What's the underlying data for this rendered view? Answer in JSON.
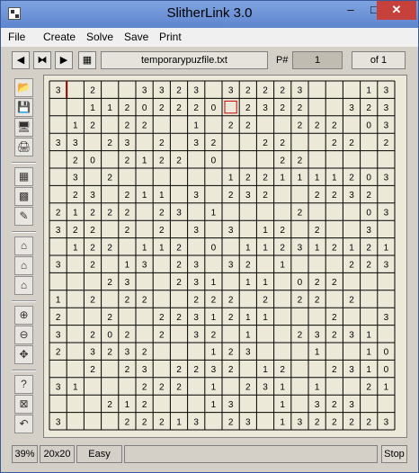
{
  "window": {
    "title": "SlitherLink 3.0"
  },
  "titlebar_buttons": {
    "minimize": "–",
    "maximize": "□",
    "close": "✕"
  },
  "menu": [
    "File",
    "Create",
    "Solve",
    "Save",
    "Print"
  ],
  "toolbar": {
    "nav_icons": [
      "first-icon",
      "prev-icon",
      "next-icon",
      "grid-icon"
    ],
    "filename": "temporarypuzfile.txt",
    "puzzle_label": "P#",
    "puzzle_number": "1",
    "puzzle_of": "of 1"
  },
  "sidebar_icons": [
    "open-folder-icon",
    "save-disk-icon",
    "computer-icon",
    "printer-icon",
    "grid-icon",
    "grid-pattern-icon",
    "edit-puzzle-icon",
    "house-icon",
    "house-icon",
    "house-icon",
    "zoom-in-icon",
    "zoom-out-icon",
    "move-icon",
    "help-icon",
    "cancel-icon",
    "undo-icon"
  ],
  "status": {
    "percent": "39%",
    "size": "20x20",
    "difficulty": "Easy",
    "message": "",
    "stop_label": "Stop"
  },
  "board": {
    "rows": 20,
    "cols": 20,
    "selected_cell": [
      1,
      10
    ],
    "cells": [
      [
        "3",
        "",
        "2",
        "",
        "",
        "3",
        "3",
        "2",
        "3",
        "",
        "3",
        "2",
        "2",
        "2",
        "3",
        "",
        "",
        "",
        "1",
        "3"
      ],
      [
        "",
        "",
        "1",
        "1",
        "2",
        "0",
        "2",
        "2",
        "2",
        "0",
        "",
        "2",
        "3",
        "2",
        "2",
        "",
        "",
        "3",
        "2",
        "3"
      ],
      [
        "",
        "1",
        "2",
        "",
        "2",
        "2",
        "",
        "",
        "1",
        "",
        "2",
        "2",
        "",
        "",
        "2",
        "2",
        "2",
        "",
        "0",
        "3"
      ],
      [
        "3",
        "3",
        "",
        "2",
        "3",
        "",
        "2",
        "",
        "3",
        "2",
        "",
        "",
        "2",
        "2",
        "",
        "",
        "2",
        "2",
        "",
        "2"
      ],
      [
        "",
        "2",
        "0",
        "",
        "2",
        "1",
        "2",
        "2",
        "",
        "0",
        "",
        "",
        "",
        "2",
        "2",
        "",
        "",
        "",
        "",
        ""
      ],
      [
        "",
        "3",
        "",
        "2",
        "",
        "",
        "",
        "",
        "",
        "",
        "1",
        "2",
        "2",
        "1",
        "1",
        "1",
        "1",
        "2",
        "0",
        "3"
      ],
      [
        "",
        "2",
        "3",
        "",
        "2",
        "1",
        "1",
        "",
        "3",
        "",
        "2",
        "3",
        "2",
        "",
        "",
        "2",
        "2",
        "3",
        "2",
        ""
      ],
      [
        "2",
        "1",
        "2",
        "2",
        "2",
        "",
        "2",
        "3",
        "",
        "1",
        "",
        "",
        "",
        "",
        "2",
        "",
        "",
        "",
        "0",
        "3"
      ],
      [
        "3",
        "2",
        "2",
        "",
        "2",
        "",
        "2",
        "",
        "3",
        "",
        "3",
        "",
        "1",
        "2",
        "",
        "2",
        "",
        "",
        "3",
        ""
      ],
      [
        "",
        "1",
        "2",
        "2",
        "",
        "1",
        "1",
        "2",
        "",
        "0",
        "",
        "1",
        "1",
        "2",
        "3",
        "1",
        "2",
        "1",
        "2",
        "1"
      ],
      [
        "3",
        "",
        "2",
        "",
        "1",
        "3",
        "",
        "2",
        "3",
        "",
        "3",
        "2",
        "",
        "1",
        "",
        "",
        "",
        "2",
        "2",
        "3"
      ],
      [
        "",
        "",
        "",
        "2",
        "3",
        "",
        "",
        "2",
        "3",
        "1",
        "",
        "1",
        "1",
        "",
        "0",
        "2",
        "2",
        "",
        "",
        ""
      ],
      [
        "1",
        "",
        "2",
        "",
        "2",
        "2",
        "",
        "",
        "2",
        "2",
        "2",
        "",
        "2",
        "",
        "2",
        "2",
        "",
        "2",
        "",
        ""
      ],
      [
        "2",
        "",
        "",
        "2",
        "",
        "",
        "2",
        "2",
        "3",
        "1",
        "2",
        "1",
        "1",
        "",
        "",
        "",
        "2",
        "",
        "",
        "3"
      ],
      [
        "3",
        "",
        "2",
        "0",
        "2",
        "",
        "2",
        "",
        "3",
        "2",
        "",
        "1",
        "",
        "",
        "2",
        "3",
        "2",
        "3",
        "1",
        ""
      ],
      [
        "2",
        "",
        "3",
        "2",
        "3",
        "2",
        "",
        "",
        "",
        "1",
        "2",
        "3",
        "",
        "",
        "",
        "1",
        "",
        "",
        "1",
        "0"
      ],
      [
        "",
        "",
        "2",
        "",
        "2",
        "3",
        "",
        "2",
        "2",
        "3",
        "2",
        "",
        "1",
        "2",
        "",
        "",
        "2",
        "3",
        "1",
        "0"
      ],
      [
        "3",
        "1",
        "",
        "",
        "",
        "2",
        "2",
        "2",
        "",
        "1",
        "",
        "2",
        "3",
        "1",
        "",
        "1",
        "",
        "",
        "2",
        "1"
      ],
      [
        "",
        "",
        "",
        "2",
        "1",
        "2",
        "",
        "",
        "",
        "1",
        "3",
        "",
        "",
        "1",
        "",
        "3",
        "2",
        "3",
        "",
        ""
      ],
      [
        "3",
        "",
        "",
        "",
        "2",
        "2",
        "2",
        "1",
        "3",
        "",
        "2",
        "3",
        "",
        "1",
        "3",
        "2",
        "2",
        "2",
        "2",
        "3"
      ]
    ]
  }
}
